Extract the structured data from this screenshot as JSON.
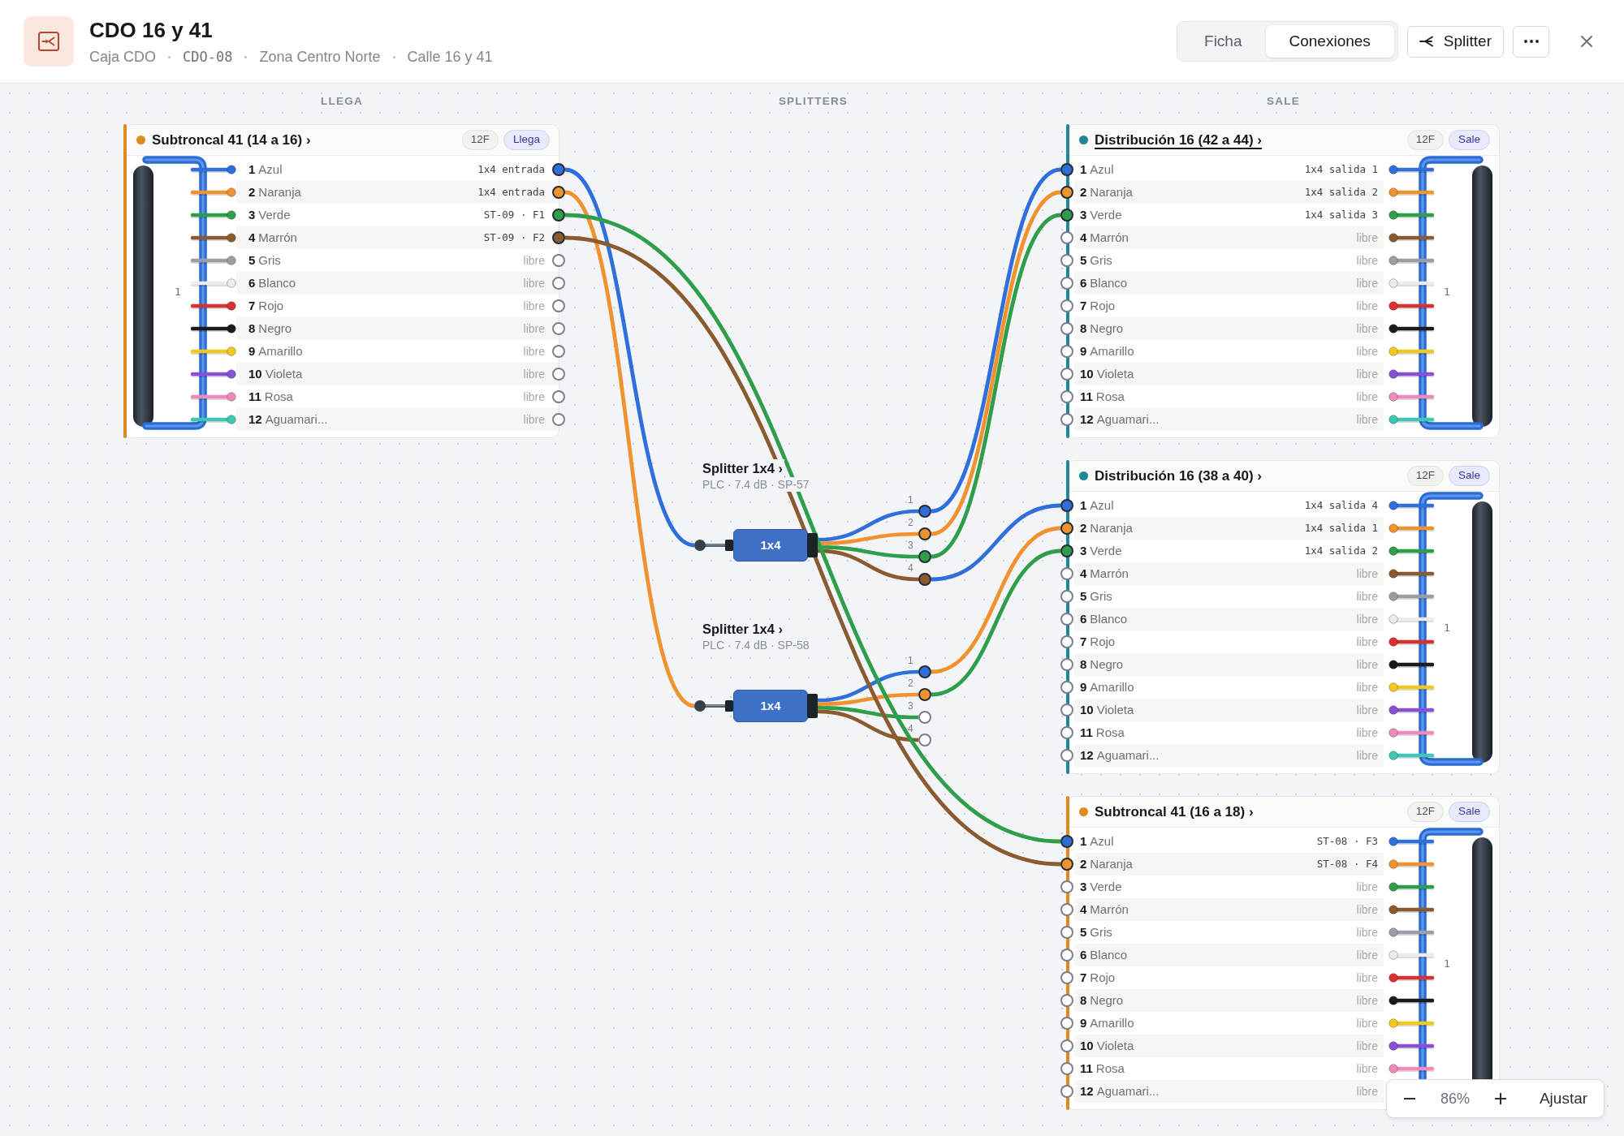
{
  "header": {
    "title": "CDO 16 y 41",
    "subtitle": [
      {
        "kind": "text",
        "text": "Caja CDO"
      },
      {
        "kind": "code",
        "text": "CDO-08"
      },
      {
        "kind": "text",
        "text": "Zona Centro Norte"
      },
      {
        "kind": "text",
        "text": "Calle 16 y 41"
      }
    ],
    "tabs": [
      {
        "label": "Ficha",
        "selected": false
      },
      {
        "label": "Conexiones",
        "selected": true
      }
    ],
    "actions": [
      {
        "kind": "splitter",
        "label": "Splitter"
      },
      {
        "kind": "more"
      },
      {
        "kind": "close"
      }
    ]
  },
  "columns": [
    "LLEGA",
    "SPLITTERS",
    "SALE"
  ],
  "panels": [
    {
      "kind": "incoming",
      "title": "Subtroncal 41 (14 a 16) ›",
      "color": "#e08a1e",
      "hovered": false,
      "count": "12F",
      "direction": "Llega",
      "tube_label": "1",
      "rows": [
        {
          "number": "1",
          "name": "Azul",
          "color": "#2f6fdb",
          "assignment": "1x4 entrada",
          "connected": true
        },
        {
          "number": "2",
          "name": "Naranja",
          "color": "#f0922e",
          "assignment": "1x4 entrada",
          "connected": true
        },
        {
          "number": "3",
          "name": "Verde",
          "color": "#2f9e4b",
          "assignment": "ST-09 · F1",
          "connected": true
        },
        {
          "number": "4",
          "name": "Marrón",
          "color": "#8b5a2e",
          "assignment": "ST-09 · F2",
          "connected": true
        },
        {
          "number": "5",
          "name": "Gris",
          "color": "#9a9fa6",
          "assignment": "libre",
          "connected": false
        },
        {
          "number": "6",
          "name": "Blanco",
          "color": "#ececec",
          "assignment": "libre",
          "connected": false
        },
        {
          "number": "7",
          "name": "Rojo",
          "color": "#dc2f2f",
          "assignment": "libre",
          "connected": false
        },
        {
          "number": "8",
          "name": "Negro",
          "color": "#1b1b1b",
          "assignment": "libre",
          "connected": false
        },
        {
          "number": "9",
          "name": "Amarillo",
          "color": "#f2c81f",
          "assignment": "libre",
          "connected": false
        },
        {
          "number": "10",
          "name": "Violeta",
          "color": "#8a4fd8",
          "assignment": "libre",
          "connected": false
        },
        {
          "number": "11",
          "name": "Rosa",
          "color": "#ef8ab9",
          "assignment": "libre",
          "connected": false
        },
        {
          "number": "12",
          "name": "Aguamari...",
          "color": "#3cc8b4",
          "assignment": "libre",
          "connected": false
        }
      ]
    },
    {
      "kind": "outgoing",
      "title": "Distribución 16 (42 a 44) ›",
      "color": "#1f8798",
      "hovered": true,
      "count": "12F",
      "direction": "Sale",
      "tube_label": "1",
      "rows": [
        {
          "number": "1",
          "name": "Azul",
          "color": "#2f6fdb",
          "assignment": "1x4 salida 1",
          "connected": true
        },
        {
          "number": "2",
          "name": "Naranja",
          "color": "#f0922e",
          "assignment": "1x4 salida 2",
          "connected": true
        },
        {
          "number": "3",
          "name": "Verde",
          "color": "#2f9e4b",
          "assignment": "1x4 salida 3",
          "connected": true
        },
        {
          "number": "4",
          "name": "Marrón",
          "color": "#8b5a2e",
          "assignment": "libre",
          "connected": false
        },
        {
          "number": "5",
          "name": "Gris",
          "color": "#9a9fa6",
          "assignment": "libre",
          "connected": false
        },
        {
          "number": "6",
          "name": "Blanco",
          "color": "#ececec",
          "assignment": "libre",
          "connected": false
        },
        {
          "number": "7",
          "name": "Rojo",
          "color": "#dc2f2f",
          "assignment": "libre",
          "connected": false
        },
        {
          "number": "8",
          "name": "Negro",
          "color": "#1b1b1b",
          "assignment": "libre",
          "connected": false
        },
        {
          "number": "9",
          "name": "Amarillo",
          "color": "#f2c81f",
          "assignment": "libre",
          "connected": false
        },
        {
          "number": "10",
          "name": "Violeta",
          "color": "#8a4fd8",
          "assignment": "libre",
          "connected": false
        },
        {
          "number": "11",
          "name": "Rosa",
          "color": "#ef8ab9",
          "assignment": "libre",
          "connected": false
        },
        {
          "number": "12",
          "name": "Aguamari...",
          "color": "#3cc8b4",
          "assignment": "libre",
          "connected": false
        }
      ]
    },
    {
      "kind": "outgoing",
      "title": "Distribución 16 (38 a 40) ›",
      "color": "#1f8798",
      "hovered": false,
      "count": "12F",
      "direction": "Sale",
      "tube_label": "1",
      "rows": [
        {
          "number": "1",
          "name": "Azul",
          "color": "#2f6fdb",
          "assignment": "1x4 salida 4",
          "connected": true
        },
        {
          "number": "2",
          "name": "Naranja",
          "color": "#f0922e",
          "assignment": "1x4 salida 1",
          "connected": true
        },
        {
          "number": "3",
          "name": "Verde",
          "color": "#2f9e4b",
          "assignment": "1x4 salida 2",
          "connected": true
        },
        {
          "number": "4",
          "name": "Marrón",
          "color": "#8b5a2e",
          "assignment": "libre",
          "connected": false
        },
        {
          "number": "5",
          "name": "Gris",
          "color": "#9a9fa6",
          "assignment": "libre",
          "connected": false
        },
        {
          "number": "6",
          "name": "Blanco",
          "color": "#ececec",
          "assignment": "libre",
          "connected": false
        },
        {
          "number": "7",
          "name": "Rojo",
          "color": "#dc2f2f",
          "assignment": "libre",
          "connected": false
        },
        {
          "number": "8",
          "name": "Negro",
          "color": "#1b1b1b",
          "assignment": "libre",
          "connected": false
        },
        {
          "number": "9",
          "name": "Amarillo",
          "color": "#f2c81f",
          "assignment": "libre",
          "connected": false
        },
        {
          "number": "10",
          "name": "Violeta",
          "color": "#8a4fd8",
          "assignment": "libre",
          "connected": false
        },
        {
          "number": "11",
          "name": "Rosa",
          "color": "#ef8ab9",
          "assignment": "libre",
          "connected": false
        },
        {
          "number": "12",
          "name": "Aguamari...",
          "color": "#3cc8b4",
          "assignment": "libre",
          "connected": false
        }
      ]
    },
    {
      "kind": "outgoing",
      "title": "Subtroncal 41 (16 a 18) ›",
      "color": "#e08a1e",
      "hovered": false,
      "count": "12F",
      "direction": "Sale",
      "tube_label": "1",
      "rows": [
        {
          "number": "1",
          "name": "Azul",
          "color": "#2f6fdb",
          "assignment": "ST-08 · F3",
          "connected": true
        },
        {
          "number": "2",
          "name": "Naranja",
          "color": "#f0922e",
          "assignment": "ST-08 · F4",
          "connected": true
        },
        {
          "number": "3",
          "name": "Verde",
          "color": "#2f9e4b",
          "assignment": "libre",
          "connected": false
        },
        {
          "number": "4",
          "name": "Marrón",
          "color": "#8b5a2e",
          "assignment": "libre",
          "connected": false
        },
        {
          "number": "5",
          "name": "Gris",
          "color": "#9a9fa6",
          "assignment": "libre",
          "connected": false
        },
        {
          "number": "6",
          "name": "Blanco",
          "color": "#ececec",
          "assignment": "libre",
          "connected": false
        },
        {
          "number": "7",
          "name": "Rojo",
          "color": "#dc2f2f",
          "assignment": "libre",
          "connected": false
        },
        {
          "number": "8",
          "name": "Negro",
          "color": "#1b1b1b",
          "assignment": "libre",
          "connected": false
        },
        {
          "number": "9",
          "name": "Amarillo",
          "color": "#f2c81f",
          "assignment": "libre",
          "connected": false
        },
        {
          "number": "10",
          "name": "Violeta",
          "color": "#8a4fd8",
          "assignment": "libre",
          "connected": false
        },
        {
          "number": "11",
          "name": "Rosa",
          "color": "#ef8ab9",
          "assignment": "libre",
          "connected": false
        },
        {
          "number": "12",
          "name": "Aguamari...",
          "assignment": "libre",
          "connected": false
        }
      ]
    }
  ],
  "splitters": [
    {
      "title": "Splitter 1x4 ›",
      "details": "PLC · 7.4 dB · SP-57",
      "ratio": "1x4",
      "outputs": [
        {
          "label": "1",
          "color": "#2f6fdb",
          "connected": true
        },
        {
          "label": "2",
          "color": "#f0922e",
          "connected": true
        },
        {
          "label": "3",
          "color": "#2f9e4b",
          "connected": true
        },
        {
          "label": "4",
          "color": "#8b5a2e",
          "connected": true
        }
      ]
    },
    {
      "title": "Splitter 1x4 ›",
      "details": "PLC · 7.4 dB · SP-58",
      "ratio": "1x4",
      "outputs": [
        {
          "label": "1",
          "color": "#2f6fdb",
          "connected": true
        },
        {
          "label": "2",
          "color": "#f0922e",
          "connected": true
        },
        {
          "label": "3",
          "color": "#2f9e4b",
          "connected": false
        },
        {
          "label": "4",
          "color": "#8b5a2e",
          "connected": false
        }
      ]
    }
  ],
  "wires": [
    {
      "color": "#2f6fdb"
    },
    {
      "color": "#f0922e"
    },
    {
      "color": "#2f9e4b"
    },
    {
      "color": "#8b5a2e"
    },
    {
      "color": "#2f6fdb"
    },
    {
      "color": "#f0922e"
    },
    {
      "color": "#2f9e4b"
    },
    {
      "color": "#2f6fdb"
    },
    {
      "color": "#f0922e"
    },
    {
      "color": "#2f9e4b"
    }
  ],
  "zoom": {
    "percent": "86%",
    "fit": "Ajustar"
  }
}
